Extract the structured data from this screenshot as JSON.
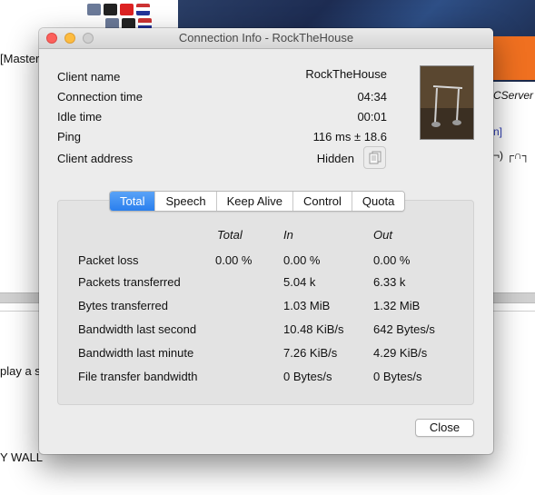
{
  "background": {
    "left_items": [
      "[Master",
      "play a s",
      "Y WALL"
    ],
    "right_items": [
      "CServer",
      "n]",
      "¬) ┌∩┐"
    ]
  },
  "window": {
    "title": "Connection Info - RockTheHouse"
  },
  "info": [
    {
      "label": "Client name",
      "value": "RockTheHouse"
    },
    {
      "label": "Connection time",
      "value": "04:34"
    },
    {
      "label": "Idle time",
      "value": "00:01"
    },
    {
      "label": "Ping",
      "value": "116 ms ± 18.6"
    },
    {
      "label": "Client address",
      "value": "Hidden"
    }
  ],
  "tabs": [
    {
      "label": "Total",
      "active": true
    },
    {
      "label": "Speech",
      "active": false
    },
    {
      "label": "Keep Alive",
      "active": false
    },
    {
      "label": "Control",
      "active": false
    },
    {
      "label": "Quota",
      "active": false
    }
  ],
  "table": {
    "headers": {
      "total": "Total",
      "in": "In",
      "out": "Out"
    },
    "rows": [
      {
        "label": "Packet loss",
        "total": "0.00 %",
        "in": "0.00 %",
        "out": "0.00 %"
      },
      {
        "label": "Packets transferred",
        "total": "",
        "in": "5.04 k",
        "out": "6.33 k"
      },
      {
        "label": "Bytes transferred",
        "total": "",
        "in": "1.03 MiB",
        "out": "1.32 MiB"
      },
      {
        "label": "Bandwidth last second",
        "total": "",
        "in": "10.48 KiB/s",
        "out": "642 Bytes/s"
      },
      {
        "label": "Bandwidth last minute",
        "total": "",
        "in": "7.26 KiB/s",
        "out": "4.29 KiB/s"
      },
      {
        "label": "File transfer bandwidth",
        "total": "",
        "in": "0 Bytes/s",
        "out": "0 Bytes/s"
      }
    ]
  },
  "buttons": {
    "close": "Close"
  },
  "colors": {
    "accent": "#2a7fee",
    "close_light": "#fc605c",
    "min_light": "#fdbc40"
  }
}
